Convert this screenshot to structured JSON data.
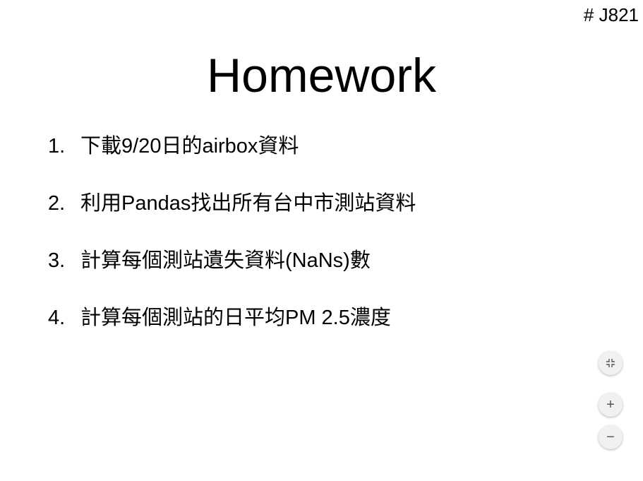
{
  "slide": {
    "id": "# J821",
    "title": "Homework",
    "items": [
      {
        "num": "1.",
        "text": "下載9/20日的airbox資料"
      },
      {
        "num": "2.",
        "text": "利用Pandas找出所有台中市測站資料"
      },
      {
        "num": "3.",
        "text": "計算每個測站遺失資料(NaNs)數"
      },
      {
        "num": "4.",
        "text": "計算每個測站的日平均PM 2.5濃度"
      }
    ]
  },
  "controls": {
    "fit_icon": "compress-icon",
    "zoom_in": "+",
    "zoom_out": "−"
  }
}
